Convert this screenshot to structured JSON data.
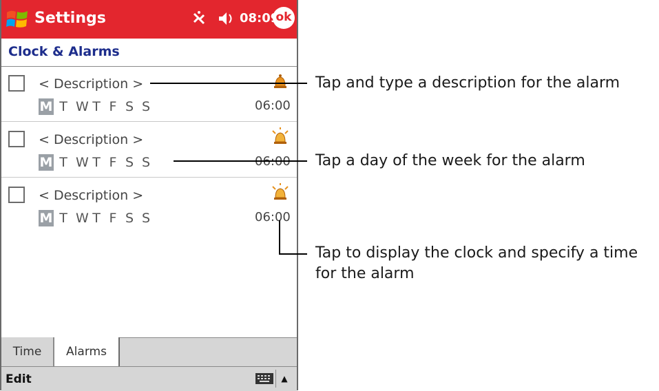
{
  "window": {
    "title": "Settings",
    "clock": "08:09",
    "ok_label": "ok"
  },
  "page": {
    "heading": "Clock & Alarms"
  },
  "alarms": [
    {
      "description": "< Description >",
      "days": [
        "M",
        "T",
        "W",
        "T",
        "F",
        "S",
        "S"
      ],
      "selected_day": "M",
      "time": "06:00",
      "enabled": false
    },
    {
      "description": "< Description >",
      "days": [
        "M",
        "T",
        "W",
        "T",
        "F",
        "S",
        "S"
      ],
      "selected_day": "M",
      "time": "06:00",
      "enabled": false
    },
    {
      "description": "< Description >",
      "days": [
        "M",
        "T",
        "W",
        "T",
        "F",
        "S",
        "S"
      ],
      "selected_day": "M",
      "time": "06:00",
      "enabled": false
    }
  ],
  "tabs": [
    {
      "label": "Time",
      "active": false
    },
    {
      "label": "Alarms",
      "active": true
    }
  ],
  "menubar": {
    "edit_label": "Edit",
    "sip_arrow": "▲"
  },
  "callouts": {
    "description": "Tap and type a description for the alarm",
    "day": "Tap a day of the week for the alarm",
    "time_line1": "Tap to display the clock and specify a time",
    "time_line2": "for the alarm"
  },
  "icons": {
    "start": "windows-flag-icon",
    "connectivity": "connectivity-icon",
    "volume": "speaker-icon",
    "alarm": "alarm-bell-icon",
    "keyboard": "keyboard-icon"
  },
  "colors": {
    "title_bar": "#e3262e",
    "heading": "#1d2d8c",
    "tab_bar": "#d6d6d6"
  }
}
